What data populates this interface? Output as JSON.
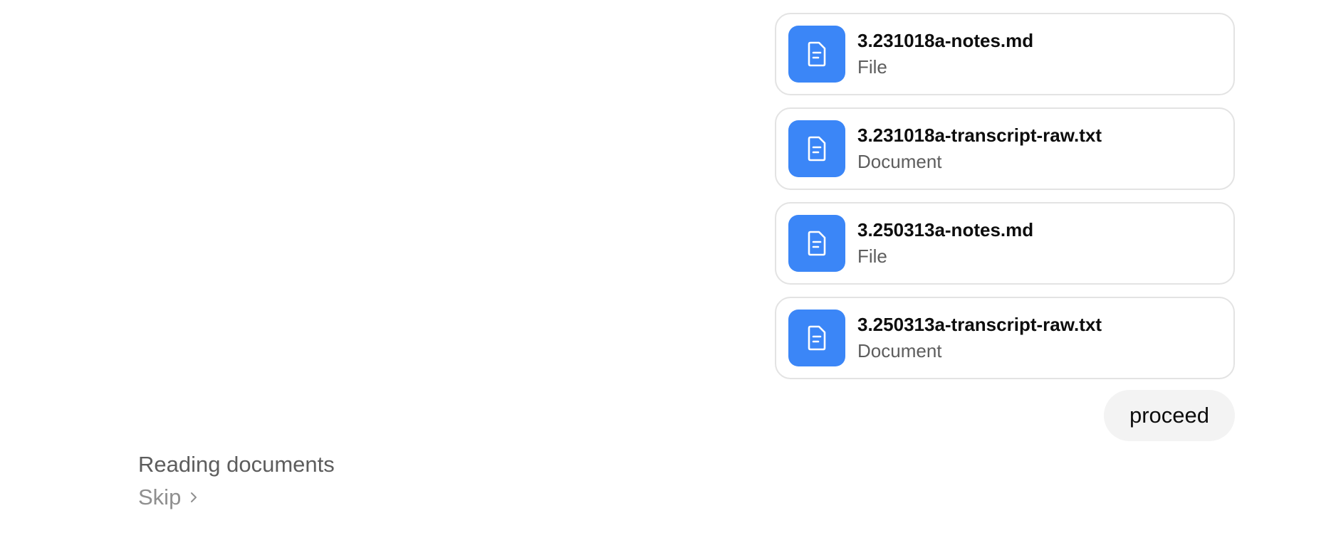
{
  "attachments": [
    {
      "name": "3.231018a-notes.md",
      "type": "File",
      "icon": "document-icon"
    },
    {
      "name": "3.231018a-transcript-raw.txt",
      "type": "Document",
      "icon": "document-icon"
    },
    {
      "name": "3.250313a-notes.md",
      "type": "File",
      "icon": "document-icon"
    },
    {
      "name": "3.250313a-transcript-raw.txt",
      "type": "Document",
      "icon": "document-icon"
    }
  ],
  "user_message": {
    "text": "proceed"
  },
  "status": {
    "title": "Reading documents",
    "skip_label": "Skip",
    "skip_icon": "chevron-right-icon"
  },
  "colors": {
    "icon_bg": "#3b86f7",
    "bubble_bg": "#f3f3f3",
    "card_border": "#e3e3e3"
  }
}
